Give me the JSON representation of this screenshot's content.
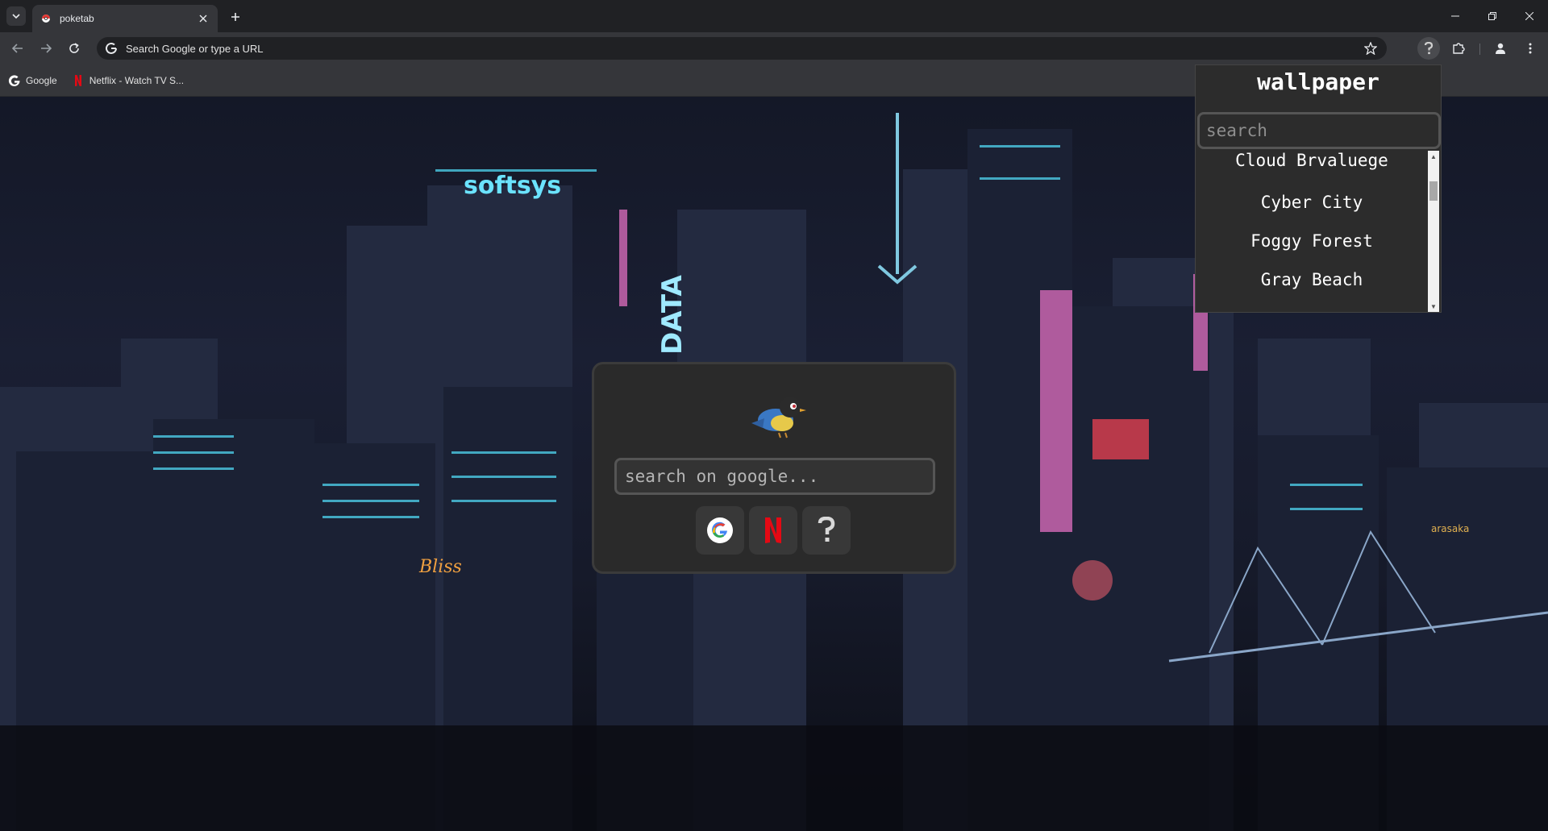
{
  "browser": {
    "tab_title": "poketab",
    "omnibox_placeholder": "Search Google or type a URL",
    "bookmarks": [
      {
        "label": "Google",
        "icon": "google-icon"
      },
      {
        "label": "Netflix - Watch TV S...",
        "icon": "netflix-icon"
      }
    ]
  },
  "newtab": {
    "search_placeholder": "search on google...",
    "quick_links": [
      {
        "name": "google",
        "icon": "google-icon"
      },
      {
        "name": "netflix",
        "icon": "netflix-icon"
      },
      {
        "name": "help",
        "icon": "question-icon"
      }
    ]
  },
  "wallpaper_panel": {
    "title": "wallpaper",
    "search_placeholder": "search",
    "items": [
      "Cloud Brvaluege",
      "Cyber City",
      "Foggy Forest",
      "Gray Beach"
    ]
  },
  "colors": {
    "accent_cyan": "#4fd6f0",
    "accent_magenta": "#d46ab8",
    "netflix_red": "#e50914",
    "panel_bg": "#2c2c2c"
  }
}
